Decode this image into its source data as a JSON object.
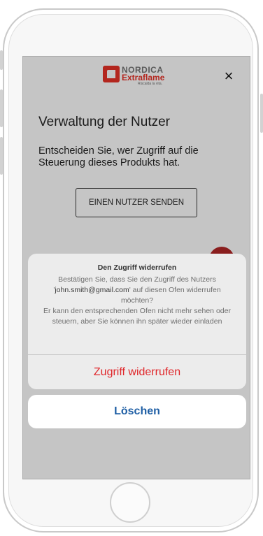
{
  "logo": {
    "brand_top": "NORDICA",
    "brand_main": "Extraflame",
    "tagline": "Riscalda la vita."
  },
  "header": {
    "close_symbol": "×"
  },
  "page": {
    "title": "Verwaltung der Nutzer",
    "description": "Entscheiden Sie, wer Zugriff auf die Steuerung dieses Produkts hat.",
    "send_button_label": "EINEN NUTZER SENDEN"
  },
  "dialog": {
    "title": "Den Zugriff widerrufen",
    "message_before": "Bestätigen Sie, dass Sie den Zugriff des Nutzers '",
    "email": "john.smith@gmail.com",
    "message_after": "' auf diesen Ofen widerrufen möchten?",
    "message_line2": "Er kann den entsprechenden Ofen nicht mehr sehen oder steuern, aber Sie können ihn später wieder einladen",
    "revoke_label": "Zugriff widerrufen",
    "cancel_label": "Löschen"
  },
  "colors": {
    "brand_red": "#b3261e",
    "destructive": "#e0262a",
    "action_blue": "#1f5fa5",
    "overlay_gray": "#c5c5c5"
  }
}
